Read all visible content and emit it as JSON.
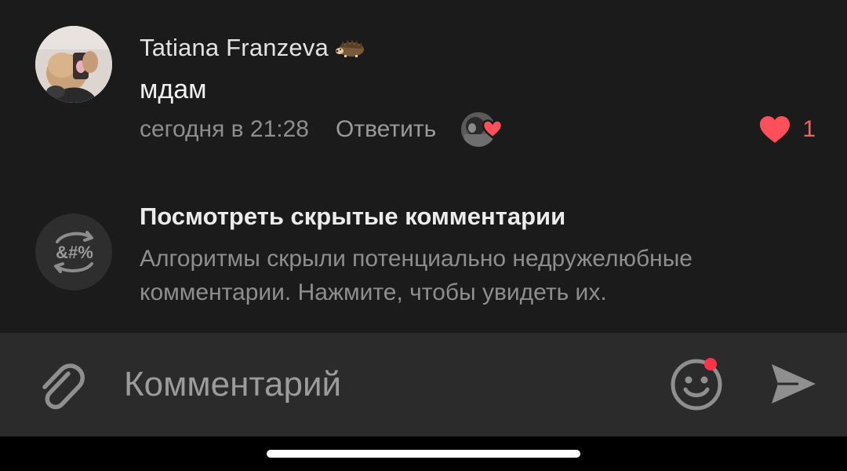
{
  "comment": {
    "author": "Tatiana Franzeva",
    "badge_icon": "hedgehog-icon",
    "text": "мдам",
    "timestamp": "сегодня в 21:28",
    "reply_label": "Ответить",
    "like_count": "1",
    "liked": true
  },
  "hidden_comments": {
    "title": "Посмотреть скрытые комментарии",
    "description": "Алгоритмы скрыли потенциально недружелюбные комментарии. Нажмите, чтобы увидеть их.",
    "icon_text": "&#%"
  },
  "input": {
    "placeholder": "Комментарий",
    "value": "",
    "attach_icon": "paperclip-icon",
    "emoji_icon": "smiley-icon",
    "send_icon": "send-icon"
  },
  "colors": {
    "background": "#1b1b1b",
    "input_bar": "#2b2b2b",
    "like_red": "#ff5c5c",
    "notification_dot": "#ff3347"
  }
}
